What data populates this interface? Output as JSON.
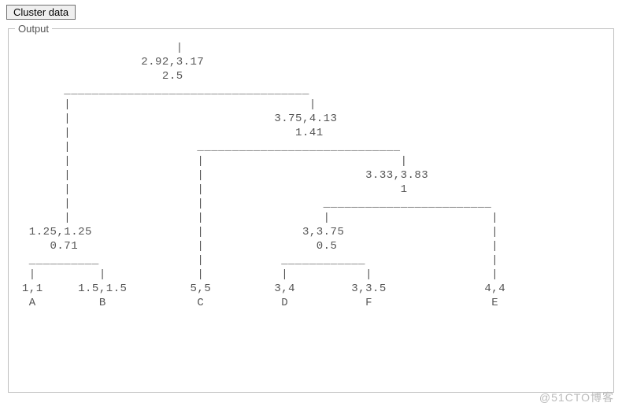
{
  "button_label": "Cluster data",
  "fieldset_legend": "Output",
  "tree": {
    "root": {
      "centroid": "2.92,3.17",
      "distance": "2.5"
    },
    "right1": {
      "centroid": "3.75,4.13",
      "distance": "1.41"
    },
    "right2": {
      "centroid": "3.33,3.83",
      "distance": "1"
    },
    "leftPair": {
      "centroid": "1.25,1.25",
      "distance": "0.71"
    },
    "dfPair": {
      "centroid": "3,3.75",
      "distance": "0.5"
    },
    "leaves": [
      {
        "coord": "1,1",
        "label": "A"
      },
      {
        "coord": "1.5,1.5",
        "label": "B"
      },
      {
        "coord": "5,5",
        "label": "C"
      },
      {
        "coord": "3,4",
        "label": "D"
      },
      {
        "coord": "3,3.5",
        "label": "F"
      },
      {
        "coord": "4,4",
        "label": "E"
      }
    ]
  },
  "treeText": "                       |\n                  2.92,3.17\n                     2.5\n       ___________________________________\n       |                                  |\n       |                             3.75,4.13\n       |                                1.41\n       |                  _____________________________\n       |                  |                            |\n       |                  |                       3.33,3.83\n       |                  |                            1\n       |                  |                 ________________________\n       |                  |                 |                       |\n  1.25,1.25               |              3,3.75                     |\n     0.71                 |                0.5                      |\n  __________              |           ____________                  |\n  |         |             |           |           |                 |\n 1,1     1.5,1.5         5,5         3,4        3,3.5              4,4\n  A         B             C           D           F                 E",
  "watermark": "@51CTO博客"
}
